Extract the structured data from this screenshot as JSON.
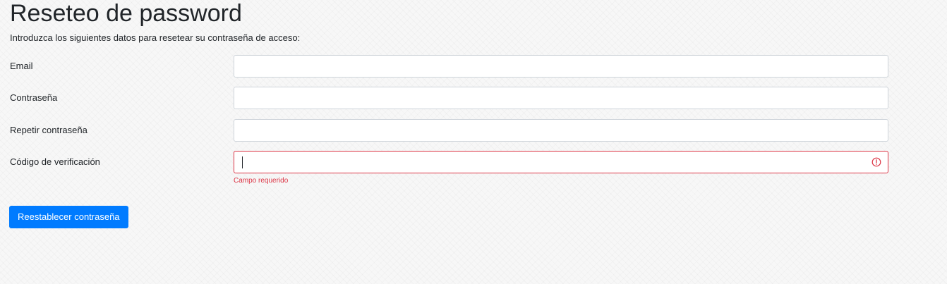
{
  "page": {
    "title": "Reseteo de password",
    "intro": "Introduzca los siguientes datos para resetear su contraseña de acceso:"
  },
  "form": {
    "fields": [
      {
        "label": "Email",
        "value": "",
        "type": "email"
      },
      {
        "label": "Contraseña",
        "value": "",
        "type": "password"
      },
      {
        "label": "Repetir contraseña",
        "value": "",
        "type": "password"
      },
      {
        "label": "Código de verificación",
        "value": "",
        "type": "text",
        "error": "Campo requerido",
        "focused": true
      }
    ],
    "submit_label": "Reestablecer contraseña"
  },
  "colors": {
    "primary": "#007bff",
    "danger": "#dc3545",
    "input_border": "#ced4da",
    "text": "#212529"
  },
  "icons": {
    "error": "exclamation-circle-icon"
  }
}
